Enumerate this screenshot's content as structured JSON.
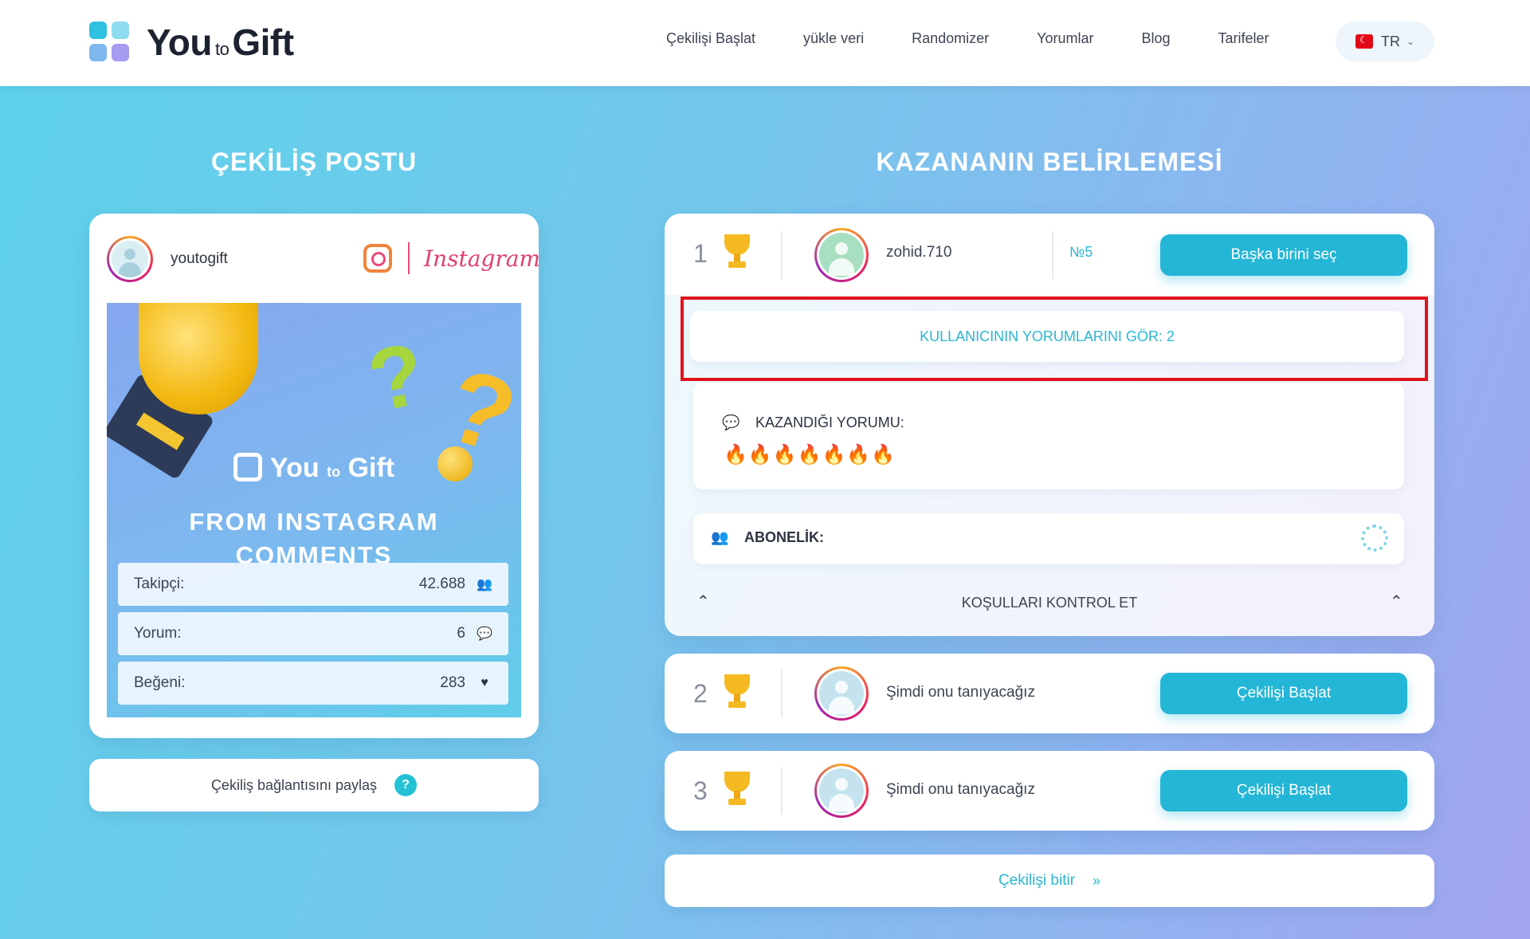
{
  "header": {
    "logo_text_main": "You",
    "logo_text_to": "to",
    "logo_text_gift": "Gift",
    "nav": [
      "Çekilişi Başlat",
      "yükle veri",
      "Randomizer",
      "Yorumlar",
      "Blog",
      "Tarifeler"
    ],
    "language": "TR",
    "colors": {
      "accent": "#24b6d6",
      "flag": "#e30a17"
    }
  },
  "left": {
    "title": "ÇEKİLİŞ POSTU",
    "username": "youtogift",
    "platform_label": "Instagram",
    "image": {
      "logo_main": "You",
      "logo_to": "to",
      "logo_gift": "Gift",
      "headline": "FROM INSTAGRAM COMMENTS"
    },
    "stats": [
      {
        "label": "Takipçi:",
        "value": "42.688",
        "icon": "users-icon"
      },
      {
        "label": "Yorum:",
        "value": "6",
        "icon": "comments-icon"
      },
      {
        "label": "Beğeni:",
        "value": "283",
        "icon": "heart-icon"
      }
    ],
    "share_label": "Çekiliş bağlantısını paylaş",
    "help_glyph": "?"
  },
  "right": {
    "title": "KAZANANIN BELİRLEMESİ",
    "winner": {
      "rank": "1",
      "username": "zohid.710",
      "number": "№5",
      "button": "Başka birini seç",
      "see_comments": "KULLANICININ YORUMLARINI GÖR: 2",
      "comment_label": "KAZANDIĞI YORUMU:",
      "comment_text": "🔥🔥🔥🔥🔥🔥🔥",
      "subscription_label": "ABONELİK:",
      "check_label": "KOŞULLARI KONTROL ET"
    },
    "pending": [
      {
        "rank": "2",
        "text": "Şimdi onu tanıyacağız",
        "button": "Çekilişi Başlat"
      },
      {
        "rank": "3",
        "text": "Şimdi onu tanıyacağız",
        "button": "Çekilişi Başlat"
      }
    ],
    "finish_label": "Çekilişi bitir",
    "finish_arrows": "»"
  }
}
